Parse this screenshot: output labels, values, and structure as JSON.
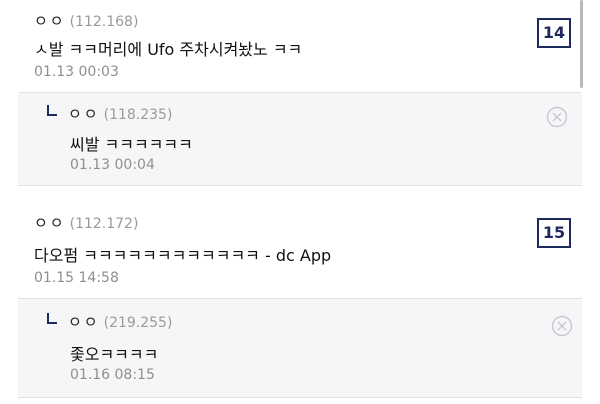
{
  "comments": [
    {
      "nickname": "ㅇㅇ",
      "ip": "(112.168)",
      "text": "ㅅ발 ㅋㅋ머리에 Ufo 주차시켜놨노 ㅋㅋ",
      "date": "01.13 00:03",
      "number": "14",
      "reply": {
        "nickname": "ㅇㅇ",
        "ip": "(118.235)",
        "text": "씨발 ㅋㅋㅋㅋㅋㅋ",
        "date": "01.13 00:04"
      }
    },
    {
      "nickname": "ㅇㅇ",
      "ip": "(112.172)",
      "text": "다오펌 ㅋㅋㅋㅋㅋㅋㅋㅋㅋㅋㅋㅋ - dc App",
      "date": "01.15 14:58",
      "number": "15",
      "reply": {
        "nickname": "ㅇㅇ",
        "ip": "(219.255)",
        "text": "좇오ㅋㅋㅋㅋ",
        "date": "01.16 08:15"
      }
    }
  ]
}
